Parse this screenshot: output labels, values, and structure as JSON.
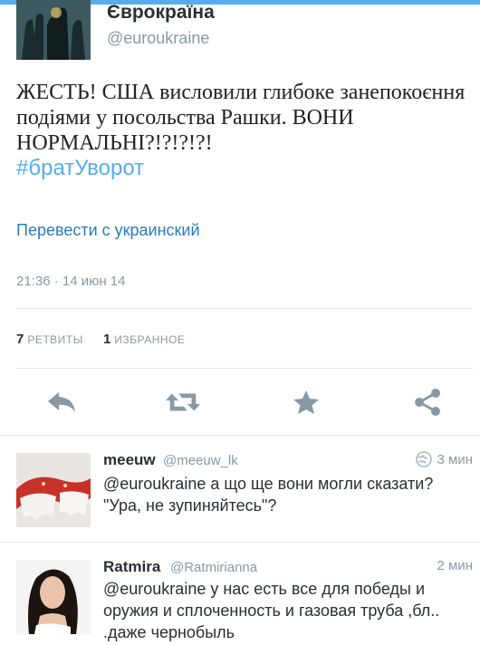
{
  "tweet": {
    "author_name": "Єврокраїна",
    "author_handle": "@euroukraine",
    "text": "ЖЕСТЬ! США висловили глибоке занепокоєння подіями у посольства Рашки. ВОНИ НОРМАЛЬНІ?!?!?!?!",
    "hashtag": "#братУворот",
    "translate_link": "Перевести с украинский",
    "timestamp": "21:36 · 14 июн 14",
    "retweets_count": "7",
    "retweets_label": "РЕТВИТЫ",
    "favorites_count": "1",
    "favorites_label": "ИЗБРАННОЕ"
  },
  "actions": [
    {
      "name": "reply",
      "icon": "reply-icon"
    },
    {
      "name": "retweet",
      "icon": "retweet-icon"
    },
    {
      "name": "favorite",
      "icon": "star-icon"
    },
    {
      "name": "share",
      "icon": "share-icon"
    }
  ],
  "replies": [
    {
      "name": "meeuw",
      "handle": "@meeuw_lk",
      "time": "3 мин",
      "has_globe": true,
      "text": "@euroukraine а що ще вони могли сказати? \"Ура, не зупиняйтесь\"?"
    },
    {
      "name": "Ratmira",
      "handle": "@Ratmirianna",
      "time": "2 мин",
      "has_globe": false,
      "text": "@euroukraine у нас есть все для победы и оружия и сплоченность и газовая труба ,бл.. .даже чернобыль"
    }
  ],
  "colors": {
    "accent": "#55acee",
    "link": "#2b7bb9",
    "icon_gray": "#8899a6",
    "text": "#292f33"
  }
}
